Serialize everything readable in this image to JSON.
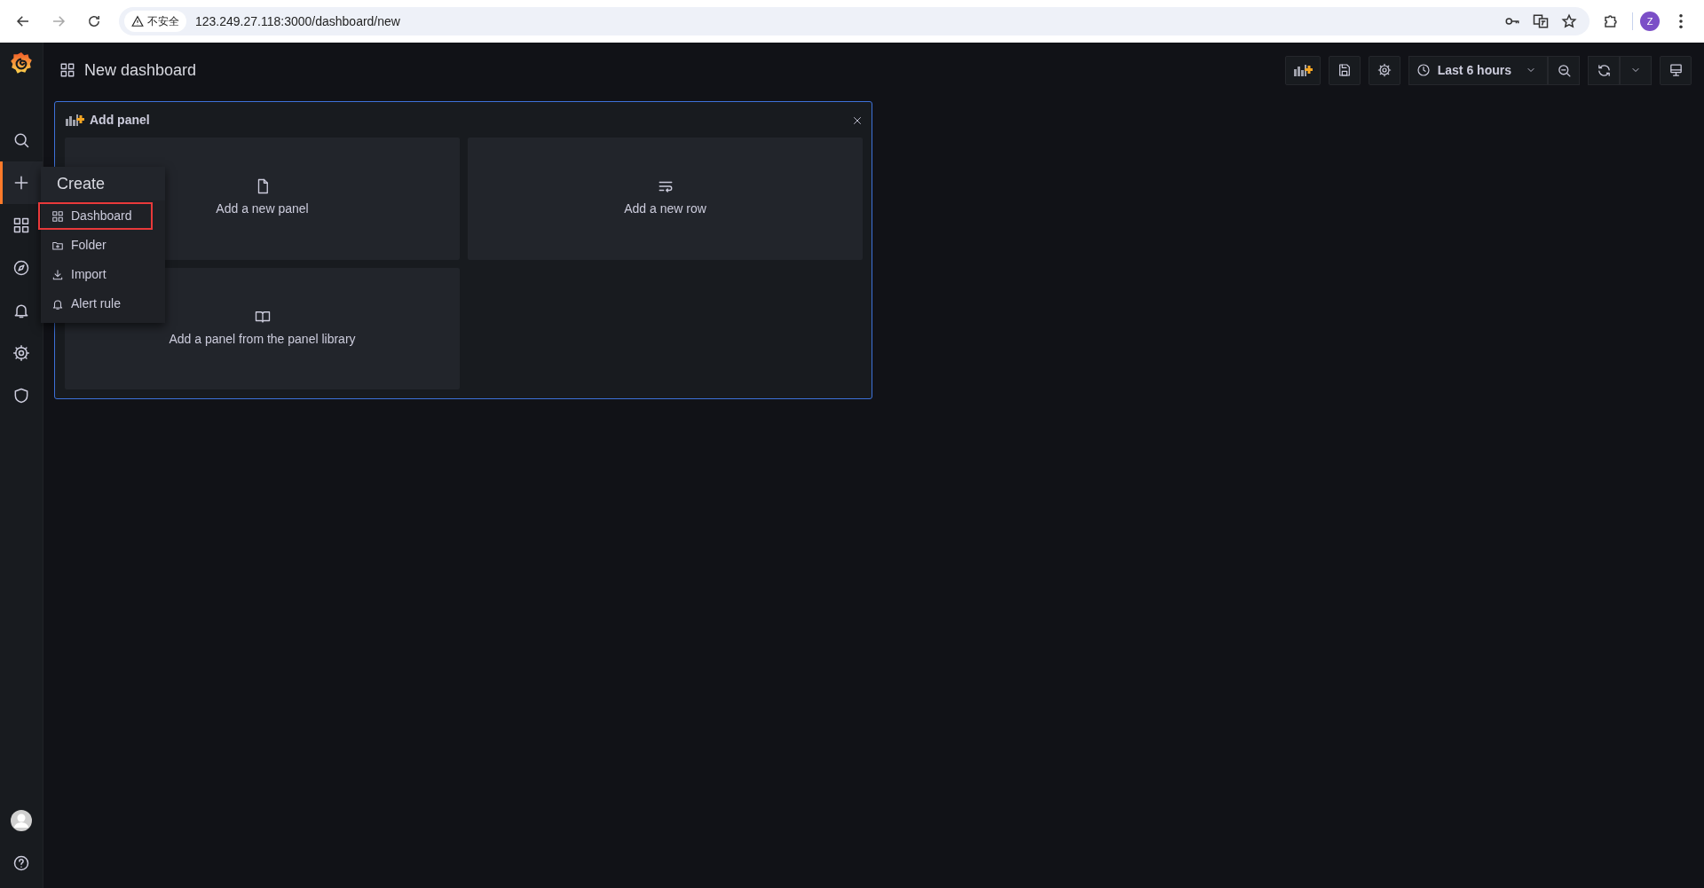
{
  "browser": {
    "back_enabled": true,
    "forward_enabled": false,
    "security_label": "不安全",
    "url": "123.249.27.118:3000/dashboard/new",
    "profile_letter": "Z"
  },
  "sidebar": {
    "items": [
      {
        "kind": "search",
        "selected": false
      },
      {
        "kind": "create",
        "selected": true
      },
      {
        "kind": "dashboards",
        "selected": false
      },
      {
        "kind": "explore",
        "selected": false
      },
      {
        "kind": "alerting",
        "selected": false
      },
      {
        "kind": "configuration",
        "selected": false
      },
      {
        "kind": "admin",
        "selected": false
      }
    ],
    "bottom_items": [
      {
        "kind": "profile"
      },
      {
        "kind": "help"
      }
    ]
  },
  "header": {
    "title": "New dashboard"
  },
  "toolbar": {
    "time_range": "Last 6 hours"
  },
  "add_panel": {
    "title": "Add panel",
    "options": [
      {
        "kind": "panel",
        "label": "Add a new panel"
      },
      {
        "kind": "row",
        "label": "Add a new row"
      },
      {
        "kind": "library",
        "label": "Add a panel from the panel library"
      }
    ]
  },
  "create_menu": {
    "title": "Create",
    "items": [
      {
        "kind": "dashboard",
        "label": "Dashboard",
        "highlighted": true
      },
      {
        "kind": "folder",
        "label": "Folder",
        "highlighted": false
      },
      {
        "kind": "import",
        "label": "Import",
        "highlighted": false
      },
      {
        "kind": "alert",
        "label": "Alert rule",
        "highlighted": false
      }
    ]
  }
}
